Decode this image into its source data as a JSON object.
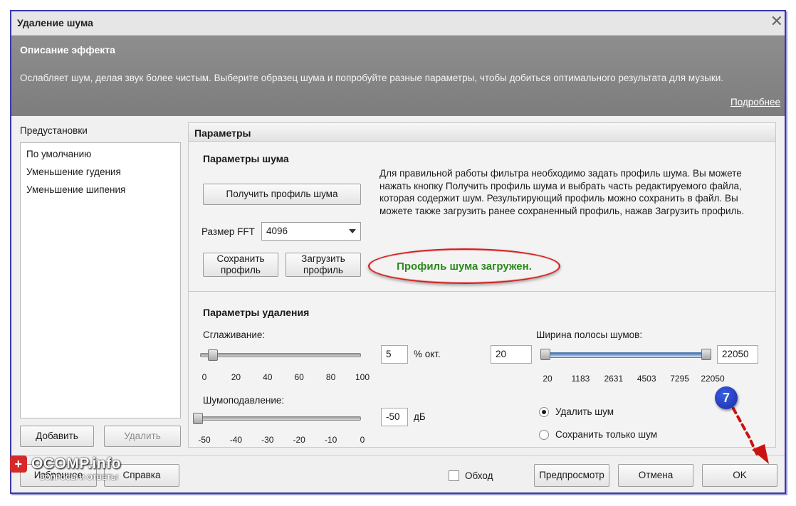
{
  "window": {
    "title": "Удаление шума",
    "close_glyph": "✕"
  },
  "description": {
    "heading": "Описание эффекта",
    "text": "Ослабляет шум, делая звук более чистым. Выберите образец шума и попробуйте разные параметры, чтобы добиться оптимального результата для музыки.",
    "more_link": "Подробнее"
  },
  "presets": {
    "label": "Предустановки",
    "items": [
      {
        "label": "По умолчанию"
      },
      {
        "label": "Уменьшение гудения"
      },
      {
        "label": "Уменьшение шипения"
      }
    ],
    "add_button": "Добавить",
    "delete_button": "Удалить"
  },
  "params": {
    "header": "Параметры",
    "noise_section": "Параметры шума",
    "get_profile_button": "Получить профиль шума",
    "fft_label": "Размер FFT",
    "fft_value": "4096",
    "save_profile_button": "Сохранить профиль",
    "load_profile_button": "Загрузить профиль",
    "info_text": "Для правильной работы фильтра необходимо задать профиль шума. Вы можете нажать кнопку Получить профиль шума и выбрать часть редактируемого файла, которая содержит шум. Результирующий профиль можно сохранить в файл. Вы можете также загрузить ранее сохраненный профиль, нажав Загрузить профиль.",
    "status": "Профиль шума загружен.",
    "removal_section": "Параметры удаления",
    "smoothing": {
      "label": "Сглаживание:",
      "value": "5",
      "unit": "% окт.",
      "ticks": [
        "0",
        "20",
        "40",
        "60",
        "80",
        "100"
      ],
      "level_fraction": 0.05
    },
    "suppression": {
      "label": "Шумоподавление:",
      "value": "-50",
      "unit": "дБ",
      "ticks": [
        "-50",
        "-40",
        "-30",
        "-20",
        "-10",
        "0"
      ],
      "level_fraction": 0.0
    },
    "bandwidth": {
      "label": "Ширина полосы шумов:",
      "min_value": "20",
      "max_value": "22050",
      "ticks": [
        "20",
        "1183",
        "2631",
        "4503",
        "7295",
        "22050"
      ]
    },
    "remove_noise_option": "Удалить шум",
    "keep_noise_option": "Сохранить только шум"
  },
  "footer": {
    "favorites_button": "Избранное",
    "help_button": "Справка",
    "bypass_label": "Обход",
    "preview_button": "Предпросмотр",
    "cancel_button": "Отмена",
    "ok_button": "OK"
  },
  "watermark": {
    "text": "OCOMP.info",
    "sub": "ВОПРОСЫ И ОТВЕТЫ"
  },
  "annotation": {
    "step_number": "7"
  },
  "colors": {
    "window_border": "#3a3aa8",
    "description_bg": "#858585",
    "status_green": "#2a8a1a",
    "highlight_red": "#d02020",
    "range_blue": "#3d70b8",
    "badge_blue": "#1a2aa8",
    "arrow_red": "#cc1111"
  }
}
